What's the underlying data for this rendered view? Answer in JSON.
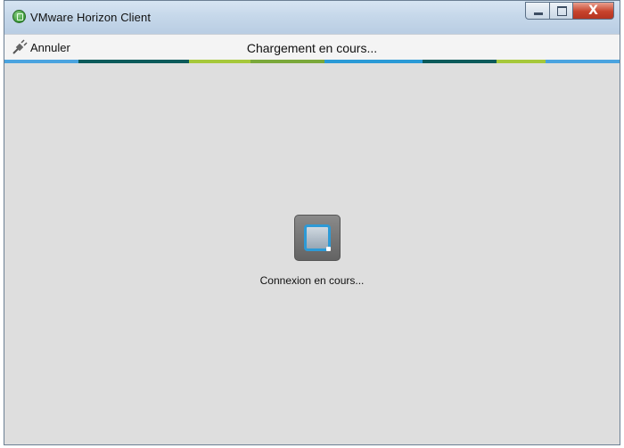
{
  "window": {
    "title": "VMware Horizon Client",
    "icon": "vmware-horizon-icon",
    "controls": {
      "minimize": "minimize-icon",
      "maximize": "maximize-icon",
      "close": "X"
    }
  },
  "toolbar": {
    "cancel_label": "Annuler",
    "cancel_icon": "disconnect-plug-icon",
    "loading_text": "Chargement en cours..."
  },
  "stripe_colors": [
    "#4aa3df",
    "#0b5a5a",
    "#a6c83a",
    "#7aa83a",
    "#2a9ad6",
    "#0b5a5a",
    "#a6c83a",
    "#4aa3df"
  ],
  "main": {
    "spinner_icon": "connecting-icon",
    "status_text": "Connexion en cours..."
  }
}
